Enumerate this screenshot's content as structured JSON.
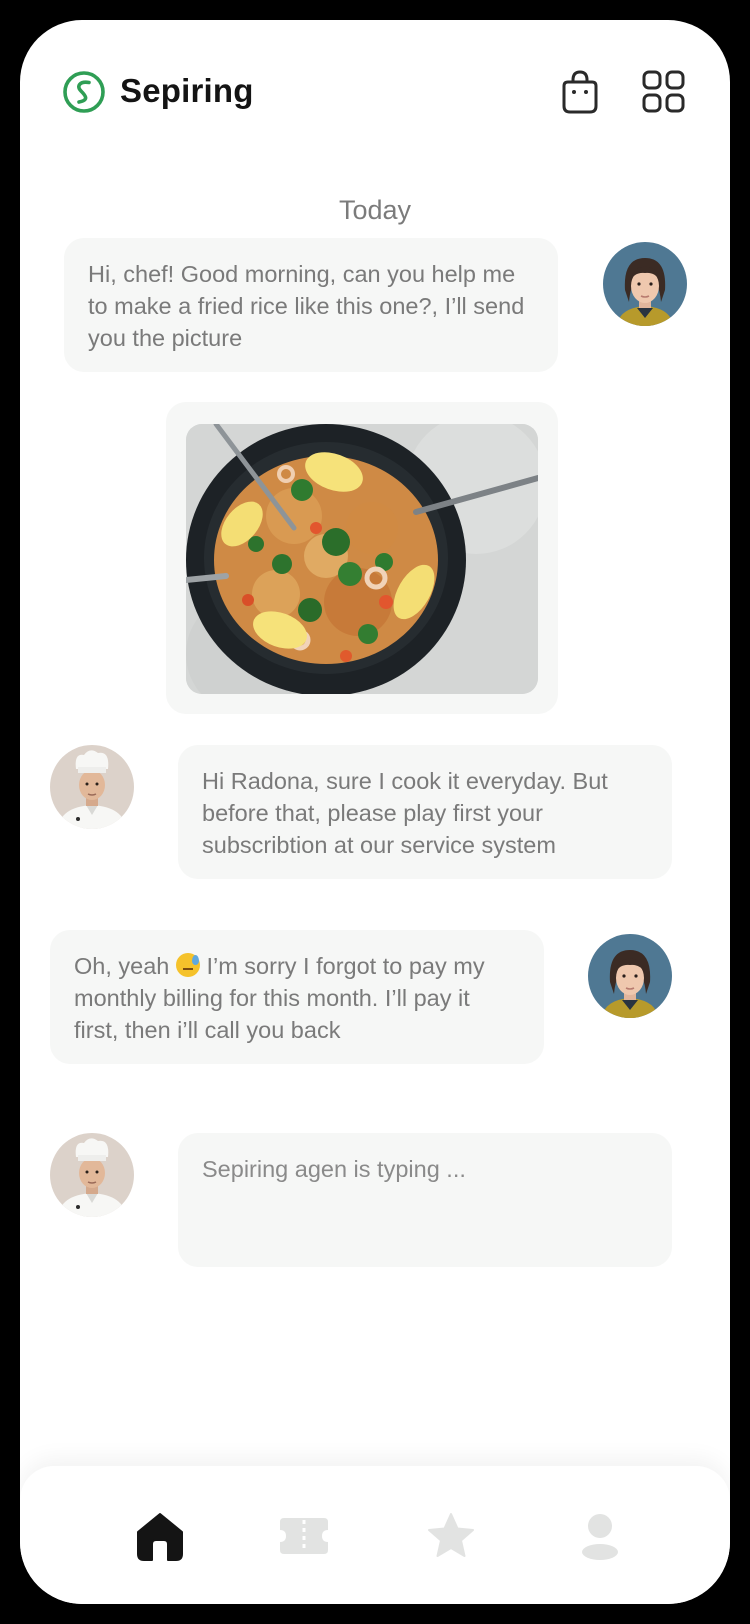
{
  "header": {
    "brand_name": "Sepiring",
    "logo_icon": "sepiring-logo-icon",
    "cart_icon": "shopping-bag-icon",
    "menu_icon": "grid-menu-icon"
  },
  "chat": {
    "date_separator": "Today",
    "messages": [
      {
        "sender": "user",
        "text": "Hi, chef! Good morning, can you help me to make a fried rice like this one?, I’ll send you the picture"
      },
      {
        "sender": "user",
        "type": "image",
        "image_subject": "fried-rice-photo"
      },
      {
        "sender": "chef",
        "text": "Hi Radona, sure I cook it everyday. But before that, please play first your subscribtion at our service system"
      },
      {
        "sender": "user",
        "text_before_emoji": "Oh, yeah",
        "emoji": "sweat-face-emoji",
        "text_after_emoji": "I’m sorry I forgot to pay my monthly billing for this month. I’ll pay it first, then i’ll call you back"
      }
    ],
    "typing_indicator": "Sepiring agen is typing ..."
  },
  "bottom_nav": {
    "items": [
      {
        "icon": "home-icon",
        "active": true
      },
      {
        "icon": "ticket-icon",
        "active": false
      },
      {
        "icon": "star-icon",
        "active": false
      },
      {
        "icon": "profile-icon",
        "active": false
      }
    ]
  },
  "colors": {
    "brand_green": "#2f9e55",
    "bubble_bg": "#f6f7f6",
    "text_gray": "#7a7a7a",
    "nav_active": "#141414",
    "nav_inactive": "#e2e3e2"
  }
}
